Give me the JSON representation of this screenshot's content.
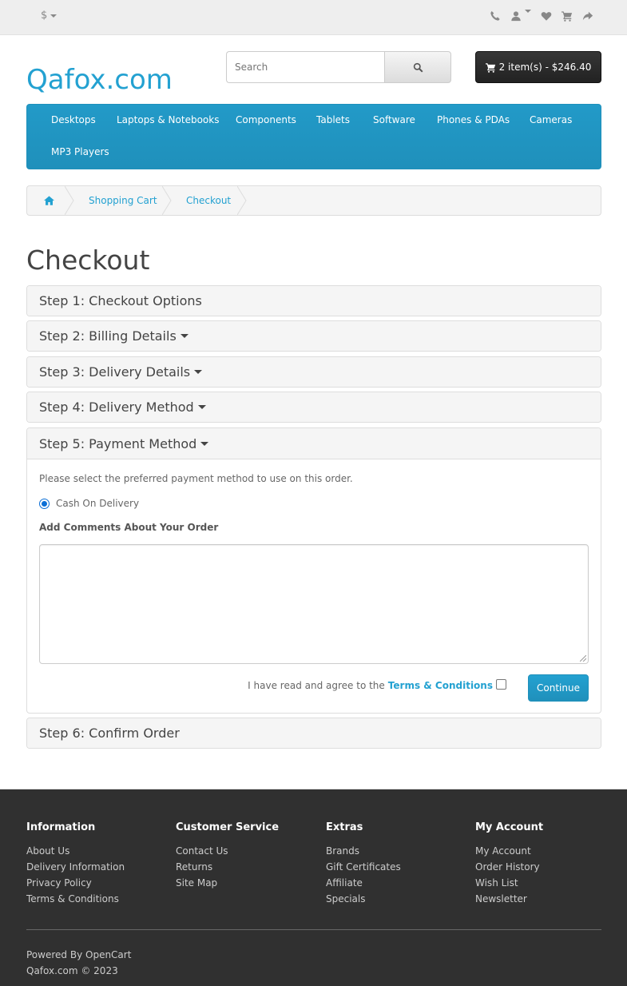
{
  "topbar": {
    "currency_symbol": "$",
    "icons": [
      "phone-icon",
      "user-icon",
      "heart-icon",
      "shopping-cart-icon",
      "share-icon"
    ]
  },
  "header": {
    "logo_text": "Qafox.com",
    "search_placeholder": "Search",
    "cart_label": "2 item(s) - $246.40"
  },
  "menu": {
    "items": [
      "Desktops",
      "Laptops & Notebooks",
      "Components",
      "Tablets",
      "Software",
      "Phones & PDAs",
      "Cameras",
      "MP3 Players"
    ]
  },
  "breadcrumb": {
    "items": [
      "Shopping Cart",
      "Checkout"
    ]
  },
  "page": {
    "title": "Checkout"
  },
  "checkout": {
    "steps": [
      "Step 1: Checkout Options",
      "Step 2: Billing Details",
      "Step 3: Delivery Details",
      "Step 4: Delivery Method",
      "Step 5: Payment Method",
      "Step 6: Confirm Order"
    ],
    "payment": {
      "intro": "Please select the preferred payment method to use on this order.",
      "method_label": "Cash On Delivery",
      "comments_label": "Add Comments About Your Order",
      "agree_text": "I have read and agree to the",
      "terms_link": "Terms & Conditions",
      "continue_label": "Continue"
    }
  },
  "footer": {
    "columns": [
      {
        "title": "Information",
        "links": [
          "About Us",
          "Delivery Information",
          "Privacy Policy",
          "Terms & Conditions"
        ]
      },
      {
        "title": "Customer Service",
        "links": [
          "Contact Us",
          "Returns",
          "Site Map"
        ]
      },
      {
        "title": "Extras",
        "links": [
          "Brands",
          "Gift Certificates",
          "Affiliate",
          "Specials"
        ]
      },
      {
        "title": "My Account",
        "links": [
          "My Account",
          "Order History",
          "Wish List",
          "Newsletter"
        ]
      }
    ],
    "powered_prefix": "Powered By",
    "powered_link": "OpenCart",
    "copyright": "Qafox.com © 2023"
  },
  "colors": {
    "accent": "#23a1d1",
    "menu_bg": "#229ac8",
    "footer_bg": "#303030"
  }
}
